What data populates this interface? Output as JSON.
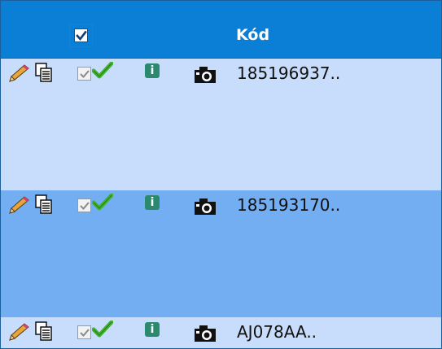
{
  "header": {
    "select_all_checked": true,
    "column_title": "Kód"
  },
  "rows": [
    {
      "code": "185196937..",
      "checked": true
    },
    {
      "code": "185193170..",
      "checked": true
    },
    {
      "code": "AJ078AA..",
      "checked": true
    }
  ],
  "icons": [
    "pencil-icon",
    "copy-icon",
    "checkbox",
    "checkmark-icon",
    "info-icon",
    "camera-icon"
  ],
  "colors": {
    "header_bg": "#0b7fd6",
    "row_light": "#c8dcfb",
    "row_selected": "#73aef3",
    "info_bg": "#2b8a6e",
    "tick_green": "#3fb52b"
  }
}
